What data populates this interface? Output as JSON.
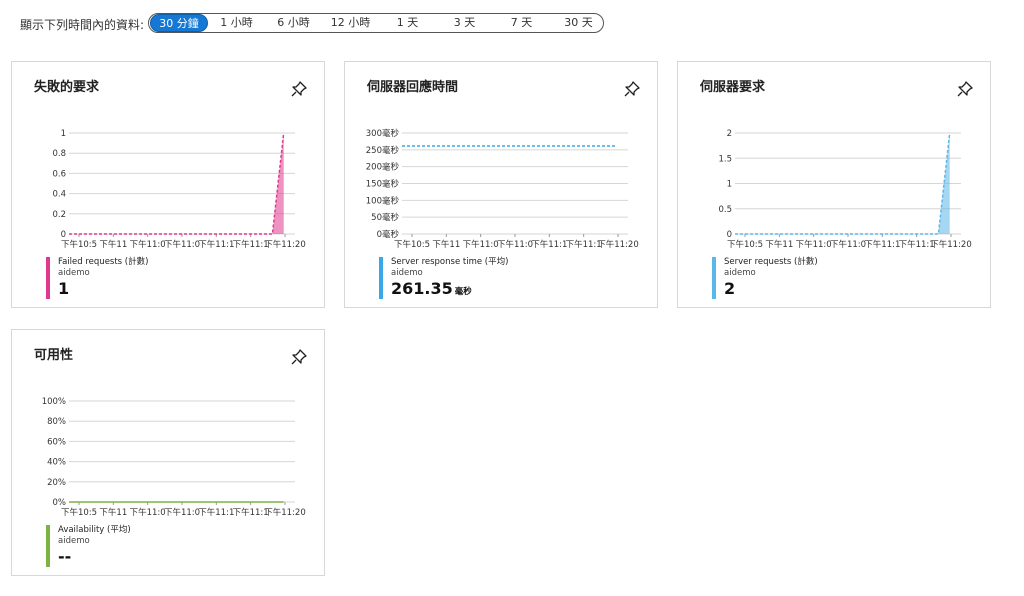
{
  "time_range": {
    "label": "顯示下列時間內的資料:",
    "options": [
      "30 分鐘",
      "1 小時",
      "6 小時",
      "12 小時",
      "1 天",
      "3 天",
      "7 天",
      "30 天"
    ],
    "selected_index": 0
  },
  "colors": {
    "failed": "#e0388f",
    "response": "#3aa8e8",
    "requests": "#5bb7ea",
    "availability": "#7cb342",
    "grid": "#d6d6d6",
    "accent": "#1578d4"
  },
  "pin_icon": "pin-icon",
  "cards": [
    {
      "title": "失敗的要求",
      "legend": {
        "name": "Failed requests (計數)",
        "resource": "aidemo",
        "value": "1",
        "unit": ""
      },
      "color_key": "failed"
    },
    {
      "title": "伺服器回應時間",
      "legend": {
        "name": "Server response time (平均)",
        "resource": "aidemo",
        "value": "261.35",
        "unit": "毫秒"
      },
      "color_key": "response"
    },
    {
      "title": "伺服器要求",
      "legend": {
        "name": "Server requests (計數)",
        "resource": "aidemo",
        "value": "2",
        "unit": ""
      },
      "color_key": "requests"
    },
    {
      "title": "可用性",
      "legend": {
        "name": "Availability (平均)",
        "resource": "aidemo",
        "value": "--",
        "unit": ""
      },
      "color_key": "availability"
    }
  ],
  "chart_data": [
    {
      "type": "area",
      "y_ticks": [
        "0",
        "0.2",
        "0.4",
        "0.6",
        "0.8",
        "1"
      ],
      "ylim": [
        0,
        1
      ],
      "x_ticks": [
        "下午10:5",
        "下午11",
        "下午11:0",
        "下午11:0",
        "下午11:1",
        "下午11:1",
        "下午11:20"
      ],
      "xlim": [
        0,
        30
      ],
      "series": [
        {
          "name": "Failed requests (計數)",
          "x": [
            0,
            27,
            28.5
          ],
          "values": [
            0,
            0,
            1
          ]
        }
      ]
    },
    {
      "type": "line",
      "y_ticks": [
        "0毫秒",
        "50毫秒",
        "100毫秒",
        "150毫秒",
        "200毫秒",
        "250毫秒",
        "300毫秒"
      ],
      "ylim": [
        0,
        300
      ],
      "x_ticks": [
        "下午10:5",
        "下午11",
        "下午11:0",
        "下午11:0",
        "下午11:1",
        "下午11:1",
        "下午11:20"
      ],
      "xlim": [
        0,
        30
      ],
      "series": [
        {
          "name": "Server response time (平均)",
          "x": [
            0,
            28.5
          ],
          "values": [
            261.35,
            261.35
          ]
        }
      ]
    },
    {
      "type": "area",
      "y_ticks": [
        "0",
        "0.5",
        "1",
        "1.5",
        "2"
      ],
      "ylim": [
        0,
        2
      ],
      "x_ticks": [
        "下午10:5",
        "下午11",
        "下午11:0",
        "下午11:0",
        "下午11:1",
        "下午11:1",
        "下午11:20"
      ],
      "xlim": [
        0,
        30
      ],
      "series": [
        {
          "name": "Server requests (計數)",
          "x": [
            0,
            27,
            28.5
          ],
          "values": [
            0,
            0,
            2
          ]
        }
      ]
    },
    {
      "type": "line",
      "y_ticks": [
        "0%",
        "20%",
        "40%",
        "60%",
        "80%",
        "100%"
      ],
      "ylim": [
        0,
        100
      ],
      "x_ticks": [
        "下午10:5",
        "下午11",
        "下午11:0",
        "下午11:0",
        "下午11:1",
        "下午11:1",
        "下午11:20"
      ],
      "xlim": [
        0,
        30
      ],
      "series": [
        {
          "name": "Availability (平均)",
          "x": [
            0,
            28.5
          ],
          "values": [
            0,
            0
          ]
        }
      ]
    }
  ]
}
